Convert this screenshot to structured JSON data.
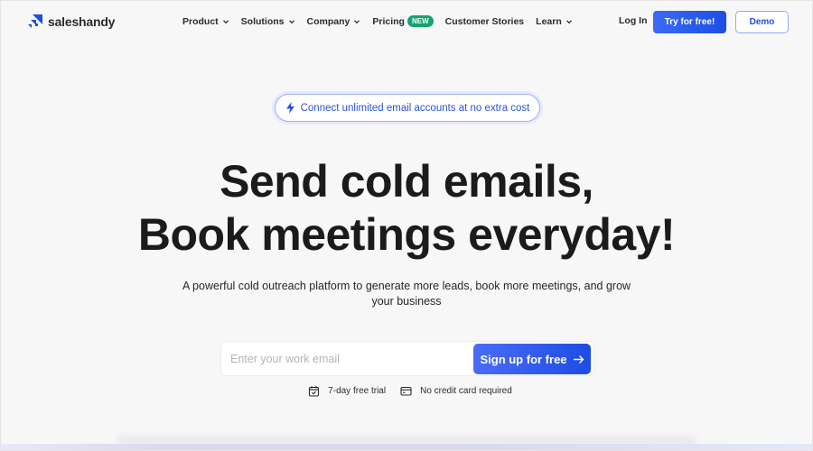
{
  "header": {
    "logo_text": "saleshandy",
    "nav": [
      {
        "label": "Product",
        "has_dropdown": true
      },
      {
        "label": "Solutions",
        "has_dropdown": true
      },
      {
        "label": "Company",
        "has_dropdown": true
      },
      {
        "label": "Pricing",
        "has_dropdown": false,
        "badge": "NEW"
      },
      {
        "label": "Customer Stories",
        "has_dropdown": false
      },
      {
        "label": "Learn",
        "has_dropdown": true
      }
    ],
    "login_label": "Log In",
    "try_label": "Try for free!",
    "demo_label": "Demo"
  },
  "hero": {
    "pill_text": "Connect unlimited email accounts at no extra cost",
    "headline_line1": "Send cold emails,",
    "headline_line2": "Book meetings everyday!",
    "subtitle": "A powerful cold outreach platform to generate more leads, book more meetings, and grow your business"
  },
  "signup": {
    "email_placeholder": "Enter your work email",
    "email_value": "",
    "button_label": "Sign up for free",
    "perks": [
      {
        "icon": "calendar-check-icon",
        "label": "7-day free trial"
      },
      {
        "icon": "credit-card-icon",
        "label": "No credit card required"
      }
    ]
  },
  "colors": {
    "brand_blue": "#1c4ee6",
    "badge_green": "#14a36f",
    "background": "#f7f7f7"
  }
}
